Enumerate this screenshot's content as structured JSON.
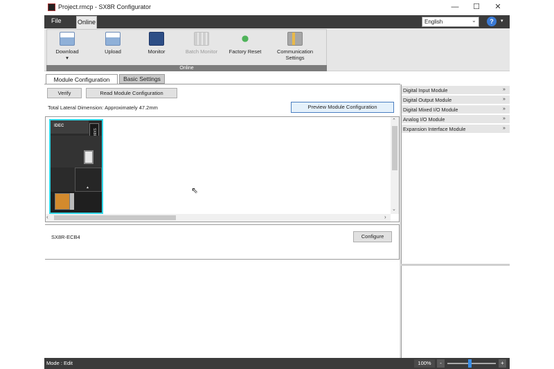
{
  "window": {
    "title": "Project.rmcp - SX8R Configurator",
    "minimize": "—",
    "maximize": "☐",
    "close": "✕"
  },
  "menu": {
    "file": "File",
    "online": "Online",
    "language": "English",
    "help": "?"
  },
  "ribbon": {
    "group_label": "Online",
    "buttons": [
      {
        "label": "Download",
        "icon": "download-icon",
        "enabled": true
      },
      {
        "label": "Upload",
        "icon": "upload-icon",
        "enabled": true
      },
      {
        "label": "Monitor",
        "icon": "monitor-icon",
        "enabled": true
      },
      {
        "label": "Batch Monitor",
        "icon": "batch-monitor-icon",
        "enabled": false
      },
      {
        "label": "Factory Reset",
        "icon": "factory-reset-icon",
        "enabled": true
      },
      {
        "label": "Communication Settings",
        "icon": "communication-settings-icon",
        "enabled": true
      }
    ]
  },
  "tabs": {
    "module_configuration": "Module Configuration",
    "basic_settings": "Basic Settings"
  },
  "toolbar": {
    "verify": "Verify",
    "read_module": "Read Module Configuration",
    "preview": "Preview Module Configuration",
    "lateral_dimension": "Total Lateral Dimension: Approximately 47.2mm"
  },
  "module": {
    "brand": "IDEC",
    "side_label": "SX8R",
    "name": "SX8R-ECB4"
  },
  "properties": {
    "configure": "Configure"
  },
  "palette": {
    "items": [
      "Digital Input Module",
      "Digital Output Module",
      "Digital Mixed I/O Module",
      "Analog I/O Module",
      "Expansion Interface Module"
    ],
    "chevron": "»"
  },
  "status": {
    "mode": "Mode : Edit",
    "zoom": "100%",
    "zoom_minus": "-",
    "zoom_plus": "+"
  }
}
